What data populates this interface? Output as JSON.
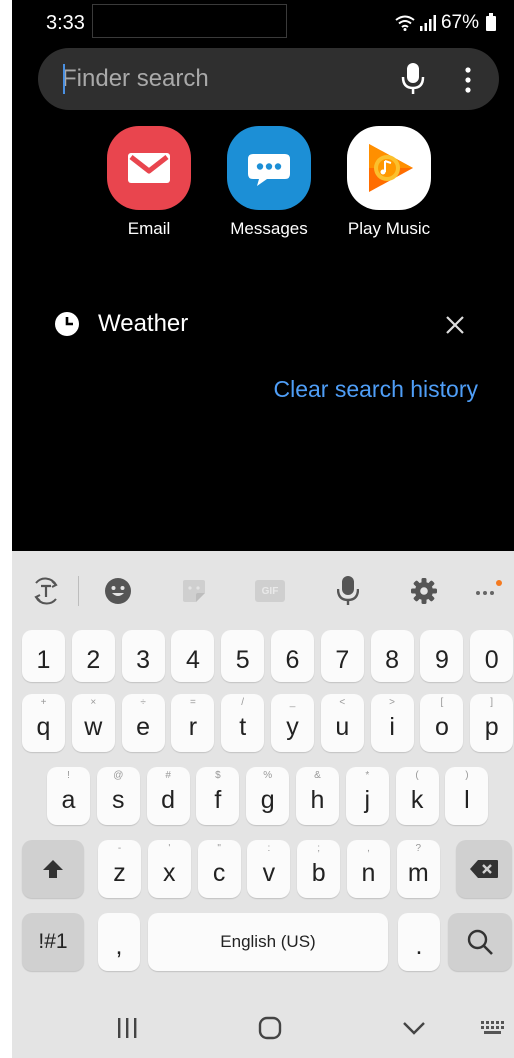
{
  "status_bar": {
    "time": "3:33",
    "battery": "67%"
  },
  "search": {
    "placeholder": "Finder search"
  },
  "apps": [
    {
      "label": "Email",
      "color": "#e9454e"
    },
    {
      "label": "Messages",
      "color": "#1c8fd6"
    },
    {
      "label": "Play Music",
      "color": "#ffffff"
    }
  ],
  "history": {
    "item": "Weather",
    "clear_label": "Clear search history"
  },
  "keyboard": {
    "numbers": [
      "1",
      "2",
      "3",
      "4",
      "5",
      "6",
      "7",
      "8",
      "9",
      "0"
    ],
    "row1": [
      {
        "key": "q",
        "hint": "+"
      },
      {
        "key": "w",
        "hint": "×"
      },
      {
        "key": "e",
        "hint": "÷"
      },
      {
        "key": "r",
        "hint": "="
      },
      {
        "key": "t",
        "hint": "/"
      },
      {
        "key": "y",
        "hint": "_"
      },
      {
        "key": "u",
        "hint": "<"
      },
      {
        "key": "i",
        "hint": ">"
      },
      {
        "key": "o",
        "hint": "["
      },
      {
        "key": "p",
        "hint": "]"
      }
    ],
    "row2": [
      {
        "key": "a",
        "hint": "!"
      },
      {
        "key": "s",
        "hint": "@"
      },
      {
        "key": "d",
        "hint": "#"
      },
      {
        "key": "f",
        "hint": "$"
      },
      {
        "key": "g",
        "hint": "%"
      },
      {
        "key": "h",
        "hint": "&"
      },
      {
        "key": "j",
        "hint": "*"
      },
      {
        "key": "k",
        "hint": "("
      },
      {
        "key": "l",
        "hint": ")"
      }
    ],
    "row3": [
      {
        "key": "z",
        "hint": "-"
      },
      {
        "key": "x",
        "hint": "'"
      },
      {
        "key": "c",
        "hint": "\""
      },
      {
        "key": "v",
        "hint": ":"
      },
      {
        "key": "b",
        "hint": ";"
      },
      {
        "key": "n",
        "hint": ","
      },
      {
        "key": "m",
        "hint": "?"
      }
    ],
    "symbols_label": "!#1",
    "comma": ",",
    "space_label": "English (US)",
    "period": ".",
    "gif_label": "GIF"
  },
  "colors": {
    "link": "#4f9ef7",
    "accent_dot": "#f47a20"
  }
}
